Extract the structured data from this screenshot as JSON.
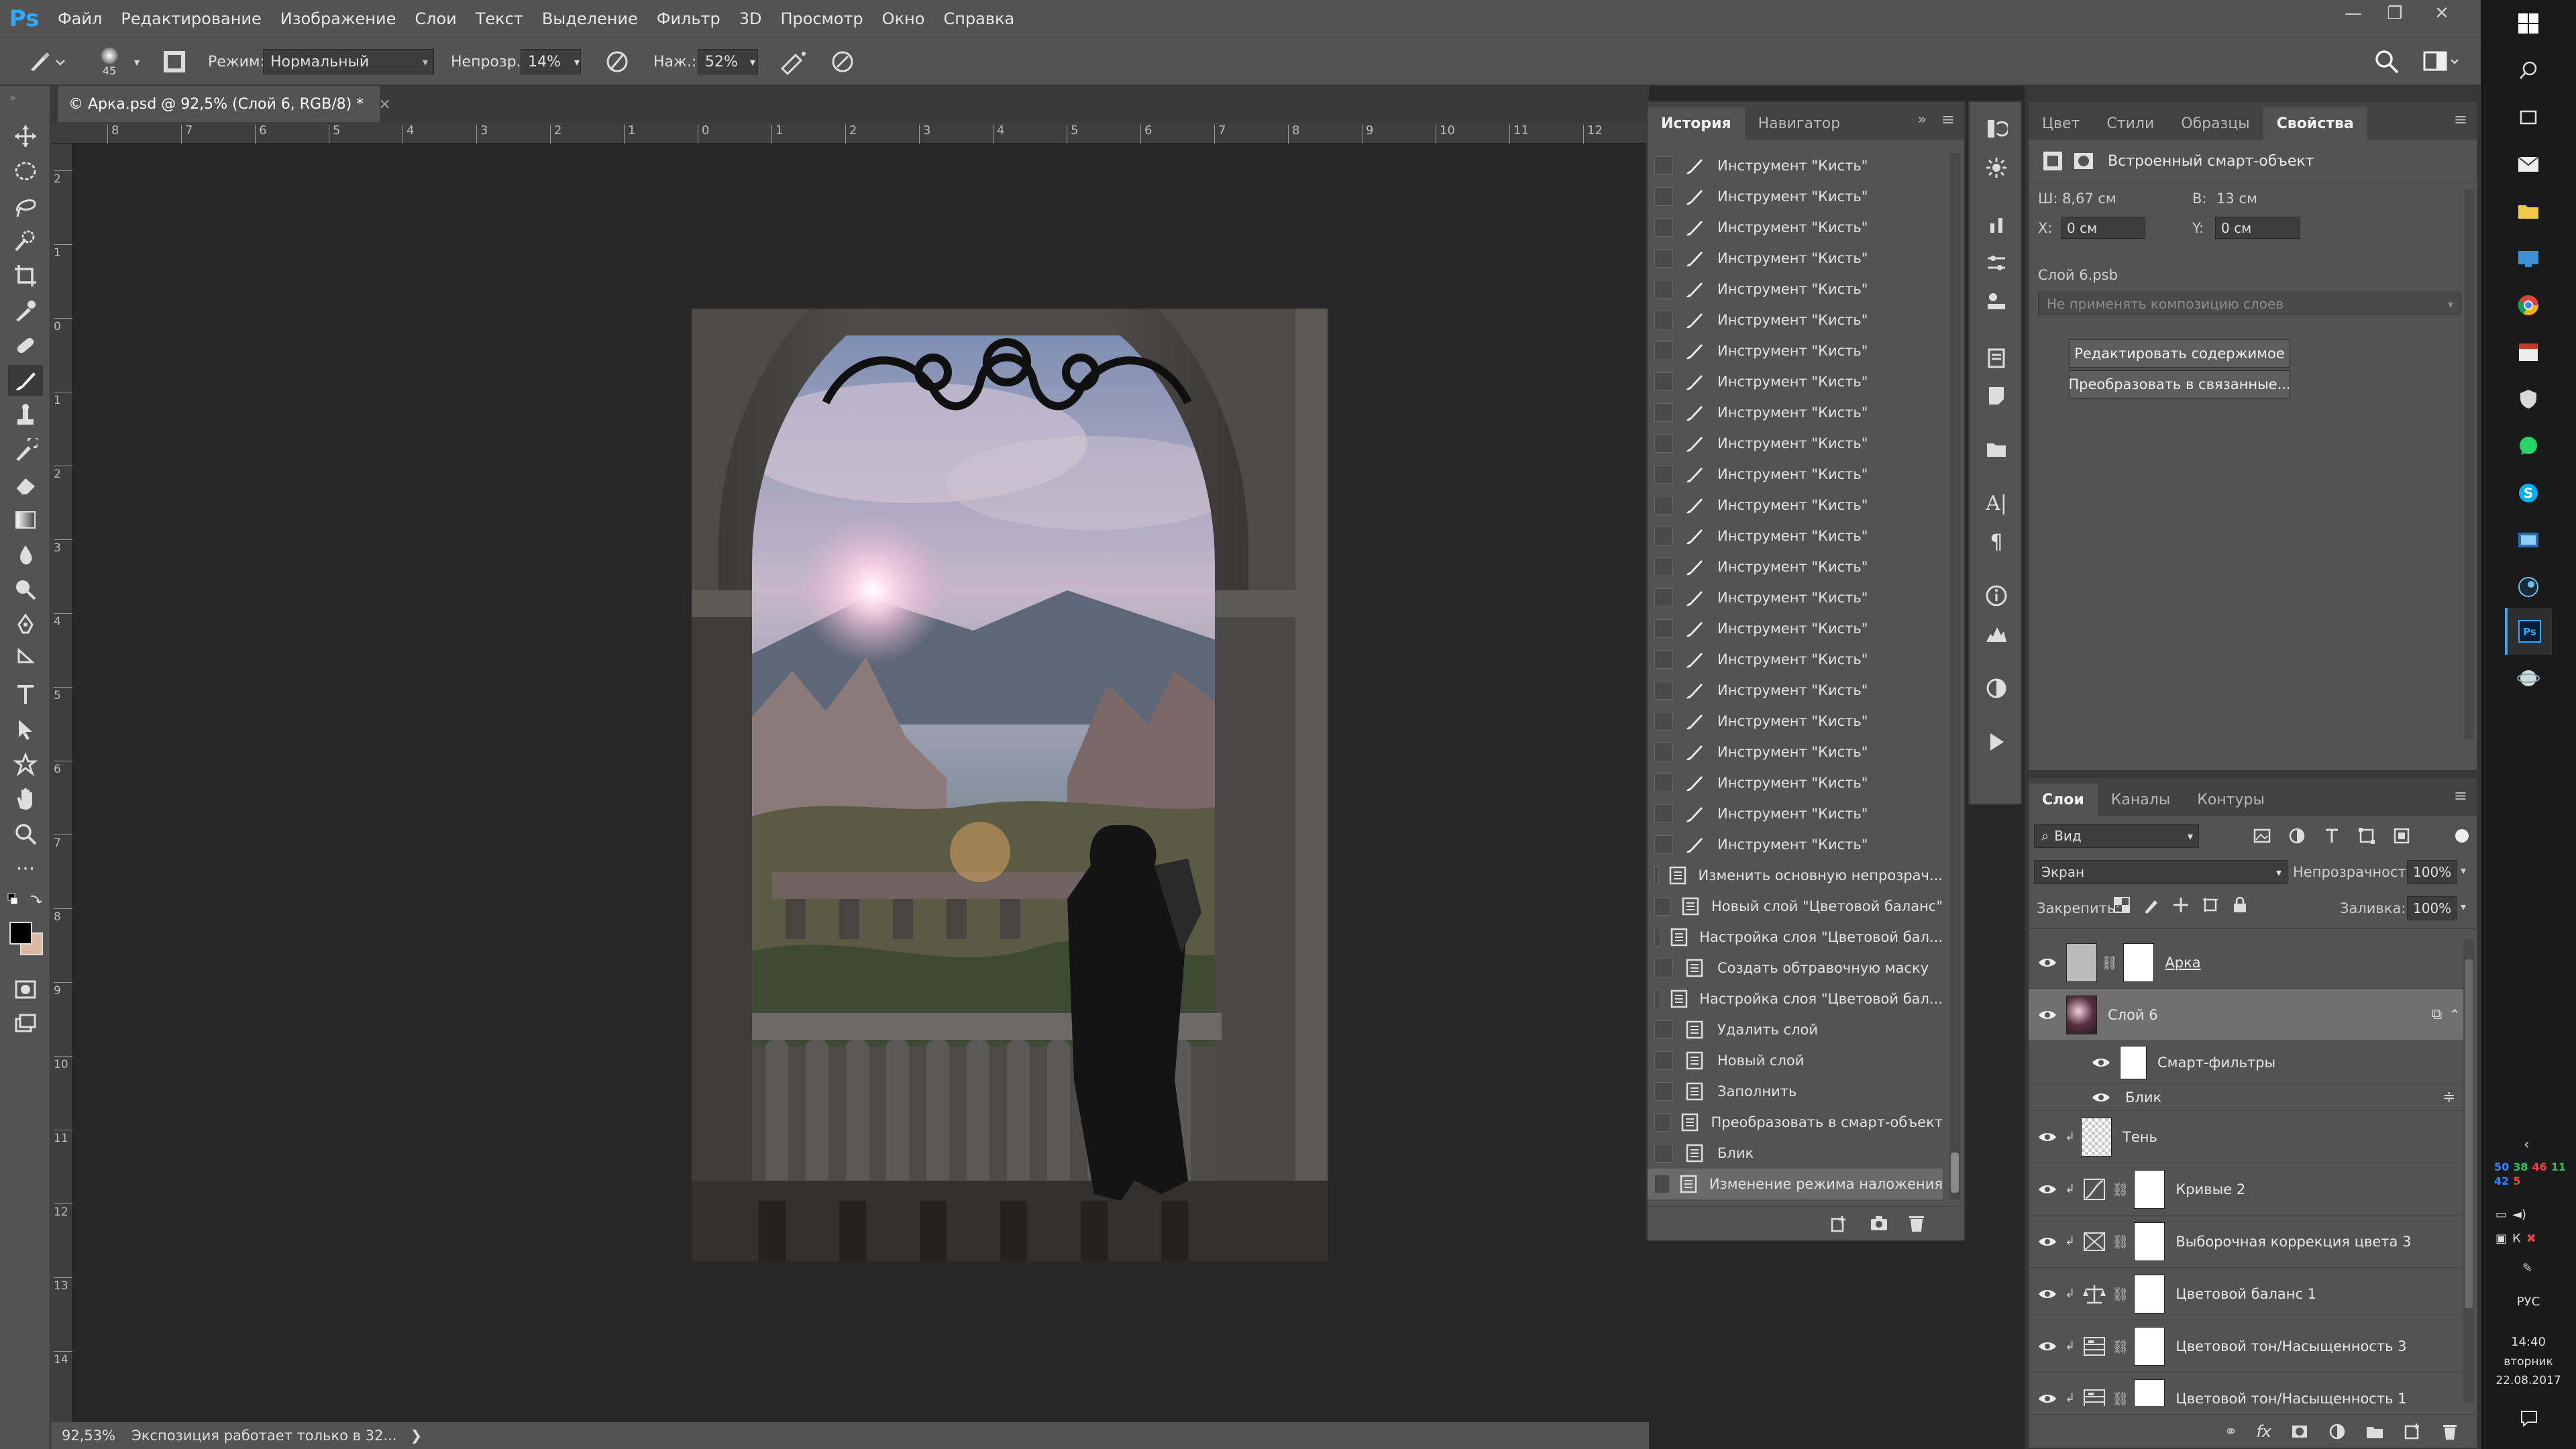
{
  "app": {
    "logo": "Ps"
  },
  "menu": [
    "Файл",
    "Редактирование",
    "Изображение",
    "Слои",
    "Текст",
    "Выделение",
    "Фильтр",
    "3D",
    "Просмотр",
    "Окно",
    "Справка"
  ],
  "window_controls": {
    "minimize": "—",
    "restore": "❐",
    "close": "✕"
  },
  "options": {
    "brush_size": "45",
    "mode_label": "Режим:",
    "mode_value": "Нормальный",
    "opacity_label": "Непрозр.:",
    "opacity_value": "14%",
    "pressure_label": "Наж.:",
    "pressure_value": "52%"
  },
  "document": {
    "tab_title": "© Арка.psd @ 92,5% (Слой 6, RGB/8) *",
    "tab_close": "×",
    "ruler_top": [
      "8",
      "7",
      "6",
      "5",
      "4",
      "3",
      "2",
      "1",
      "0",
      "1",
      "2",
      "3",
      "4",
      "5",
      "6",
      "7",
      "8",
      "9",
      "10",
      "11",
      "12"
    ],
    "ruler_left": [
      "2",
      "1",
      "0",
      "1",
      "2",
      "3",
      "4",
      "5",
      "6",
      "7",
      "8",
      "9",
      "10",
      "11",
      "12",
      "13",
      "14"
    ],
    "zoom": "92,53%",
    "status_text": "Экспозиция работает только в 32...",
    "status_arrow": "❯"
  },
  "history": {
    "tabs": [
      "История",
      "Навигатор"
    ],
    "active_tab": "История",
    "items": [
      {
        "label": "Инструмент \"Кисть\"",
        "icon": "brush-icon"
      },
      {
        "label": "Инструмент \"Кисть\"",
        "icon": "brush-icon"
      },
      {
        "label": "Инструмент \"Кисть\"",
        "icon": "brush-icon"
      },
      {
        "label": "Инструмент \"Кисть\"",
        "icon": "brush-icon"
      },
      {
        "label": "Инструмент \"Кисть\"",
        "icon": "brush-icon"
      },
      {
        "label": "Инструмент \"Кисть\"",
        "icon": "brush-icon"
      },
      {
        "label": "Инструмент \"Кисть\"",
        "icon": "brush-icon"
      },
      {
        "label": "Инструмент \"Кисть\"",
        "icon": "brush-icon"
      },
      {
        "label": "Инструмент \"Кисть\"",
        "icon": "brush-icon"
      },
      {
        "label": "Инструмент \"Кисть\"",
        "icon": "brush-icon"
      },
      {
        "label": "Инструмент \"Кисть\"",
        "icon": "brush-icon"
      },
      {
        "label": "Инструмент \"Кисть\"",
        "icon": "brush-icon"
      },
      {
        "label": "Инструмент \"Кисть\"",
        "icon": "brush-icon"
      },
      {
        "label": "Инструмент \"Кисть\"",
        "icon": "brush-icon"
      },
      {
        "label": "Инструмент \"Кисть\"",
        "icon": "brush-icon"
      },
      {
        "label": "Инструмент \"Кисть\"",
        "icon": "brush-icon"
      },
      {
        "label": "Инструмент \"Кисть\"",
        "icon": "brush-icon"
      },
      {
        "label": "Инструмент \"Кисть\"",
        "icon": "brush-icon"
      },
      {
        "label": "Инструмент \"Кисть\"",
        "icon": "brush-icon"
      },
      {
        "label": "Инструмент \"Кисть\"",
        "icon": "brush-icon"
      },
      {
        "label": "Инструмент \"Кисть\"",
        "icon": "brush-icon"
      },
      {
        "label": "Инструмент \"Кисть\"",
        "icon": "brush-icon"
      },
      {
        "label": "Инструмент \"Кисть\"",
        "icon": "brush-icon"
      },
      {
        "label": "Изменить основную непрозрач...",
        "icon": "doc-icon"
      },
      {
        "label": "Новый слой \"Цветовой баланс\"",
        "icon": "doc-icon"
      },
      {
        "label": "Настройка слоя \"Цветовой бал...",
        "icon": "doc-icon"
      },
      {
        "label": "Создать обтравочную маску",
        "icon": "doc-icon"
      },
      {
        "label": "Настройка слоя \"Цветовой бал...",
        "icon": "doc-icon"
      },
      {
        "label": "Удалить слой",
        "icon": "doc-icon"
      },
      {
        "label": "Новый слой",
        "icon": "doc-icon"
      },
      {
        "label": "Заполнить",
        "icon": "doc-icon"
      },
      {
        "label": "Преобразовать в смарт-объект",
        "icon": "doc-icon"
      },
      {
        "label": "Блик",
        "icon": "doc-icon"
      },
      {
        "label": "Изменение режима наложения",
        "icon": "doc-icon"
      }
    ]
  },
  "properties": {
    "tabs": [
      "Цвет",
      "Стили",
      "Образцы",
      "Свойства"
    ],
    "active_tab": "Свойства",
    "title": "Встроенный смарт-объект",
    "w_label": "Ш:",
    "w_value": "8,67 см",
    "h_label": "В:",
    "h_value": "13 см",
    "x_label": "X:",
    "x_value": "0 см",
    "y_label": "Y:",
    "y_value": "0 см",
    "file": "Слой 6.psb",
    "comp_placeholder": "Не применять композицию слоев",
    "edit_button": "Редактировать содержимое",
    "convert_button": "Преобразовать в связанные..."
  },
  "layers": {
    "tabs": [
      "Слои",
      "Каналы",
      "Контуры"
    ],
    "active_tab": "Слои",
    "filter": "Вид",
    "blend_mode": "Экран",
    "opacity_label": "Непрозрачность:",
    "opacity_value": "100%",
    "lock_label": "Закрепить:",
    "fill_label": "Заливка:",
    "fill_value": "100%",
    "items": [
      {
        "name": "Арка",
        "kind": "masked"
      },
      {
        "name": "Слой 6",
        "kind": "smart",
        "selected": true
      },
      {
        "name": "Смарт-фильтры",
        "kind": "filter-group"
      },
      {
        "name": "Блик",
        "kind": "filter"
      },
      {
        "name": "Тень",
        "kind": "clipped"
      },
      {
        "name": "Кривые 2",
        "kind": "adjust",
        "icon": "curves-icon"
      },
      {
        "name": "Выборочная коррекция цвета 3",
        "kind": "adjust",
        "icon": "selective-color-icon"
      },
      {
        "name": "Цветовой баланс 1",
        "kind": "adjust",
        "icon": "color-balance-icon"
      },
      {
        "name": "Цветовой тон/Насыщенность 3",
        "kind": "adjust",
        "icon": "hue-sat-icon"
      },
      {
        "name": "Цветовой тон/Насыщенность 1",
        "kind": "adjust",
        "icon": "hue-sat-icon"
      }
    ]
  },
  "taskbar": {
    "lang": "РУС",
    "time": "14:40",
    "weekday": "вторник",
    "date": "22.08.2017",
    "tray_numbers": [
      "50",
      "38",
      "46",
      "11",
      "42",
      "5"
    ]
  },
  "colors": {
    "accent": "#31a8ff",
    "panel": "#535353",
    "dark": "#383838",
    "canvas": "#282828"
  }
}
